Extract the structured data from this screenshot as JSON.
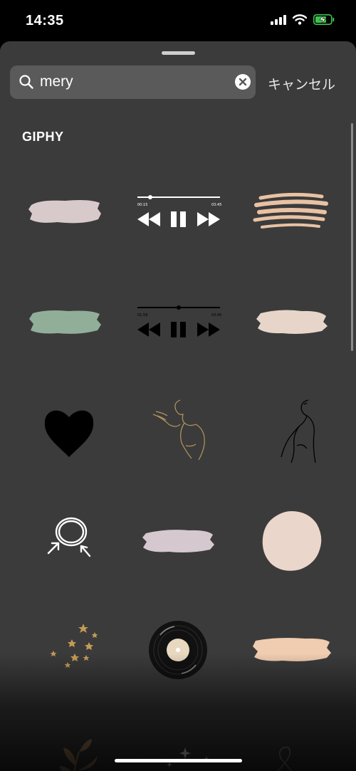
{
  "status_bar": {
    "time": "14:35"
  },
  "search": {
    "query": "mery",
    "cancel_label": "キャンセル"
  },
  "results": {
    "section_title": "GIPHY",
    "stickers": [
      "pink-brush-stroke",
      "music-player-white",
      "peach-scribble-stroke",
      "green-brush-stroke",
      "music-player-black",
      "beige-brush-stroke",
      "black-heart",
      "line-art-woman-kiss",
      "line-art-woman-profile",
      "circle-with-arrows",
      "lavender-brush-stroke",
      "beige-circle-blob",
      "gold-stars",
      "vinyl-record",
      "peach-brush-stroke",
      "leaf-branch",
      "sparkles",
      "ampersand-line"
    ]
  },
  "colors": {
    "sheet": "#3b3b3b",
    "search_field": "#5a5a5a",
    "status_bar": "#000000"
  }
}
